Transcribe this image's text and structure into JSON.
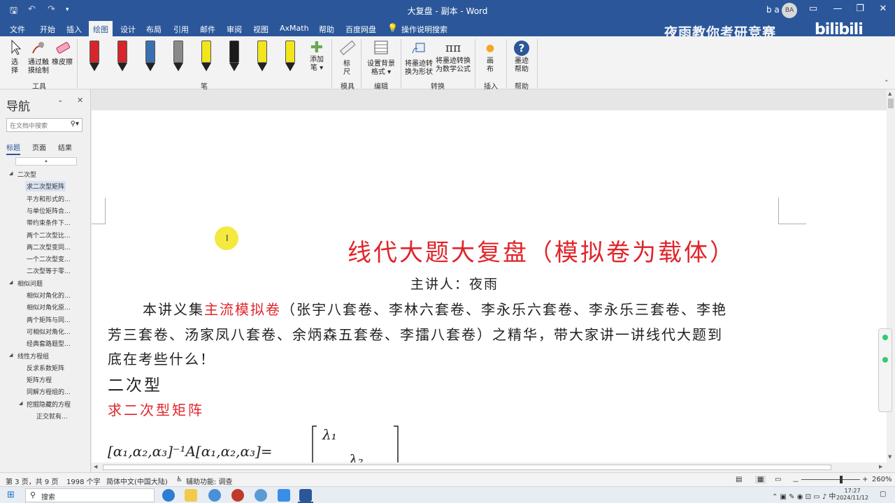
{
  "titlebar": {
    "doc_title": "大复盘 - 副本 - Word",
    "user_name": "b a",
    "user_initials": "BA",
    "qa_save": "🖫",
    "qa_undo": "↶",
    "qa_redo": "↷",
    "qa_more": "▾",
    "win_ribbon": "▭",
    "win_min": "—",
    "win_max": "❐",
    "win_close": "✕"
  },
  "tabs": [
    "文件",
    "开始",
    "插入",
    "绘图",
    "设计",
    "布局",
    "引用",
    "邮件",
    "审阅",
    "视图",
    "AxMath",
    "帮助",
    "百度网盘"
  ],
  "active_tab": "绘图",
  "tell_me": "操作说明搜索",
  "watermark": "夜雨教你考研竞赛",
  "watermark_logo": "bilibili",
  "ribbon": {
    "select_label": "选\n择",
    "touch_draw_label": "通过触\n摸绘制",
    "eraser_label": "橡皮擦",
    "group_tools": "工具",
    "add_pen_label": "添加\n笔 ▾",
    "group_pens": "笔",
    "ruler_label": "标\n尺",
    "group_stencils": "模具",
    "bg_format_label": "设置背景\n格式 ▾",
    "group_edit": "编辑",
    "ink_to_shape_label": "将墨迹转\n换为形状",
    "ink_to_math_label": "将墨迹转换\n为数学公式",
    "group_convert": "转换",
    "canvas_label": "画\n布",
    "group_insert": "插入",
    "ink_help_label": "墨迹\n帮助",
    "group_help": "帮助",
    "pen_colors": [
      "#d6262b",
      "#d6262b",
      "#3a6fb0",
      "#8a8a8a",
      "#f2e51c",
      "#1a1a1a",
      "#f2e51c",
      "#f2e51c"
    ]
  },
  "nav": {
    "title": "导航",
    "search_placeholder": "在文档中搜索",
    "tabs": [
      "标题",
      "页面",
      "结果"
    ],
    "items": [
      {
        "level": 1,
        "text": "二次型",
        "expanded": true
      },
      {
        "level": 2,
        "text": "求二次型矩阵",
        "selected": true
      },
      {
        "level": 2,
        "text": "平方和形式的..."
      },
      {
        "level": 2,
        "text": "与单位矩阵合..."
      },
      {
        "level": 2,
        "text": "带约束条件下..."
      },
      {
        "level": 2,
        "text": "两个二次型比..."
      },
      {
        "level": 2,
        "text": "两二次型变同..."
      },
      {
        "level": 2,
        "text": "一个二次型变..."
      },
      {
        "level": 2,
        "text": "二次型等于零..."
      },
      {
        "level": 1,
        "text": "相似问题",
        "expanded": true
      },
      {
        "level": 2,
        "text": "相似对角化的..."
      },
      {
        "level": 2,
        "text": "相似对角化原..."
      },
      {
        "level": 2,
        "text": "两个矩阵与同..."
      },
      {
        "level": 2,
        "text": "可相似对角化..."
      },
      {
        "level": 2,
        "text": "经典套路题型..."
      },
      {
        "level": 1,
        "text": "线性方程组",
        "expanded": true
      },
      {
        "level": 2,
        "text": "反求系数矩阵"
      },
      {
        "level": 2,
        "text": "矩阵方程"
      },
      {
        "level": 2,
        "text": "同解方程组的..."
      },
      {
        "level": 2,
        "text": "挖掘隐藏的方程",
        "expanded": true
      },
      {
        "level": 3,
        "text": "正交就有..."
      }
    ]
  },
  "document": {
    "heading": "线代大题大复盘（模拟卷为载体）",
    "speaker": "主讲人：夜雨",
    "para_prefix": "本讲义集",
    "para_highlight": "主流模拟卷",
    "para_line1_rest": "（张宇八套卷、李林六套卷、李永乐六套卷、李永乐三套卷、李艳",
    "para_line2": "芳三套卷、汤家凤八套卷、余炳森五套卷、李擂八套卷）之精华，带大家讲一讲线代大题到",
    "para_line3": "底在考些什么！",
    "section": "二次型",
    "subsection": "求二次型矩阵",
    "formula_lhs": "[α₁,α₂,α₃]⁻¹A[α₁,α₂,α₃]=",
    "matrix_l1": "λ₁",
    "matrix_l2": "λ₂"
  },
  "statusbar": {
    "page": "第 3 页，共 9 页",
    "words": "1998 个字",
    "language": "简体中文(中国大陆)",
    "accessibility": "辅助功能: 调查",
    "zoom": "260%",
    "zoom_minus": "－",
    "zoom_plus": "+"
  },
  "taskbar": {
    "search_label": "搜索",
    "time": "17:27",
    "date": "2024/11/12"
  }
}
